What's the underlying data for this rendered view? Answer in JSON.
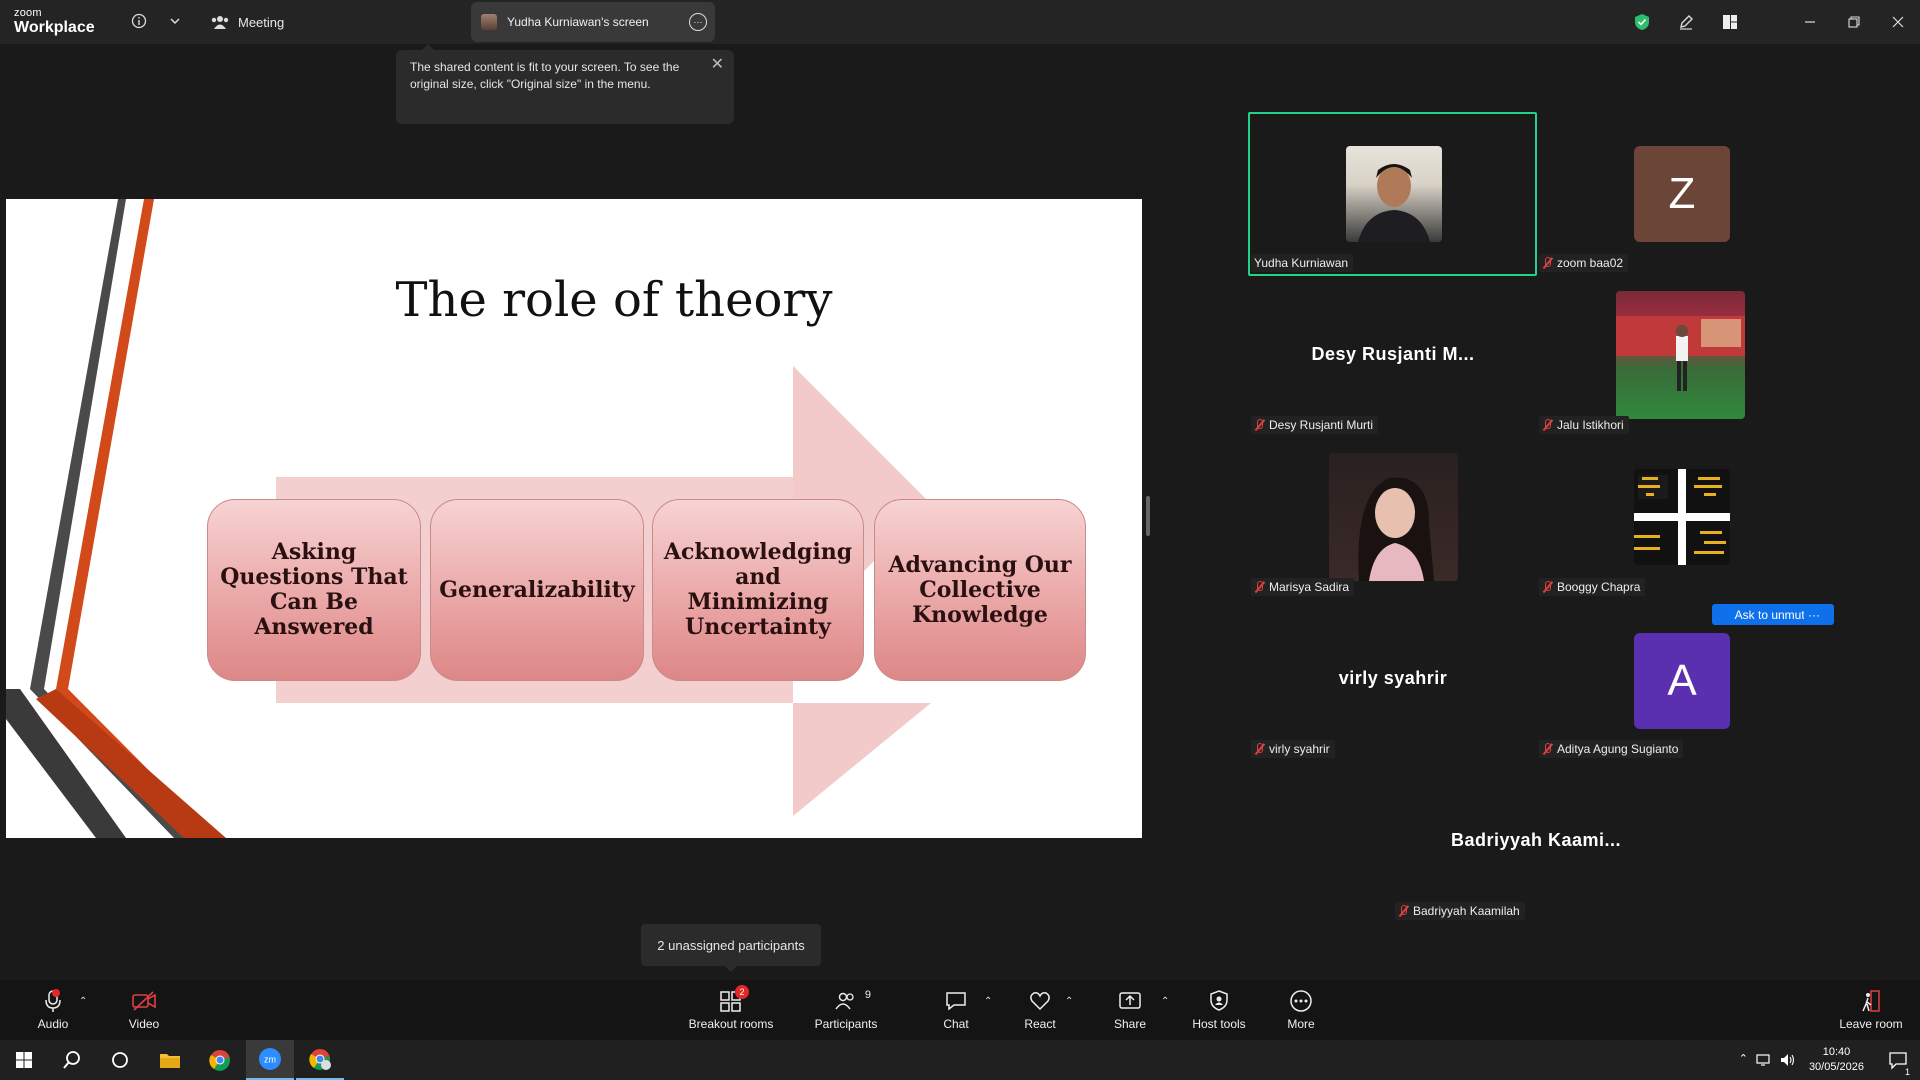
{
  "topbar": {
    "logo_small": "zoom",
    "logo_main": "Workplace",
    "meeting_label": "Meeting",
    "screen_tab_label": "Yudha Kurniawan's screen"
  },
  "tooltip": {
    "text": "The shared content is fit to your screen. To see the original size, click \"Original size\" in the menu."
  },
  "slide": {
    "title": "The role of theory",
    "boxes": [
      "Asking Questions That Can Be Answered",
      "Generalizability",
      "Acknowledging and Minimizing Uncertainty",
      "Advancing Our Collective Knowledge"
    ]
  },
  "gallery": {
    "participants": [
      {
        "name": "Yudha Kurniawan",
        "type": "video",
        "muted": false,
        "active": true
      },
      {
        "name": "zoom baa02",
        "type": "letter",
        "letter": "Z",
        "color": "#6b4538",
        "muted": true
      },
      {
        "name": "Desy Rusjanti Murti",
        "display_name": "Desy Rusjanti M...",
        "type": "name",
        "muted": true
      },
      {
        "name": "Jalu Istikhori",
        "type": "video",
        "muted": true
      },
      {
        "name": "Marisya Sadira",
        "type": "video",
        "muted": true
      },
      {
        "name": "Booggy Chapra",
        "type": "image",
        "muted": true
      },
      {
        "name": "virly syahrir",
        "display_name": "virly syahrir",
        "type": "name",
        "muted": true
      },
      {
        "name": "Aditya Agung Sugianto",
        "type": "letter",
        "letter": "A",
        "color": "#5a2fb0",
        "muted": true
      },
      {
        "name": "Badriyyah Kaamilah",
        "display_name": "Badriyyah Kaami...",
        "type": "name",
        "muted": true
      }
    ],
    "ask_unmute_label": "Ask to unmute",
    "more_label": "···"
  },
  "breakout_tooltip": "2 unassigned participants",
  "toolbar": {
    "audio": "Audio",
    "video": "Video",
    "breakout": "Breakout rooms",
    "breakout_badge": "2",
    "participants": "Participants",
    "participants_count": "9",
    "chat": "Chat",
    "react": "React",
    "share": "Share",
    "host_tools": "Host tools",
    "more": "More",
    "leave": "Leave room"
  },
  "taskbar": {
    "time": "10:40",
    "date": "30/05/2026",
    "notif_count": "1"
  },
  "colors": {
    "accent": "#0e71eb",
    "active_border": "#23d18b",
    "muted_red": "#e04040"
  }
}
